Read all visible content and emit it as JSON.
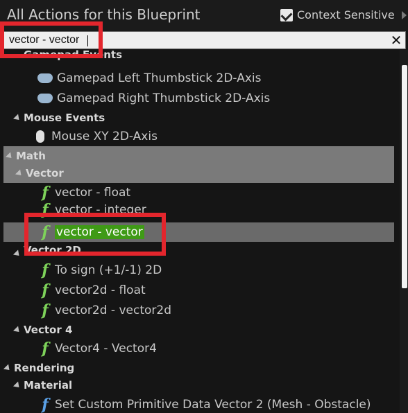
{
  "header": {
    "title": "All Actions for this Blueprint",
    "context_label": "Context Sensitive",
    "context_checked": true
  },
  "search": {
    "value": "vector - vector",
    "clear_icon": "close-icon"
  },
  "tree": {
    "partial_category": "Gamepad Events",
    "items": [
      {
        "label": "Gamepad Left Thumbstick 2D-Axis",
        "icon": "gamepad-icon"
      },
      {
        "label": "Gamepad Right Thumbstick 2D-Axis",
        "icon": "gamepad-icon"
      }
    ],
    "mouse_events": "Mouse Events",
    "mouse_xy": "Mouse XY 2D-Axis",
    "math": "Math",
    "vector": "Vector",
    "vector_float": "vector - float",
    "vector_integer": "vector - integer",
    "vector_vector": "vector - vector",
    "vector2d": "Vector 2D",
    "to_sign": "To sign (+1/-1) 2D",
    "vector2d_float": "vector2d - float",
    "vector2d_vector2d": "vector2d - vector2d",
    "vector4": "Vector 4",
    "vector4_vector4": "Vector4 - Vector4",
    "rendering": "Rendering",
    "material": "Material",
    "set_custom": "Set Custom Primitive Data Vector 2 (Mesh - Obstacle)"
  },
  "colors": {
    "highlight_red": "#e3262d",
    "function_green": "#7ed35a",
    "selection_green": "#3f9a16"
  }
}
